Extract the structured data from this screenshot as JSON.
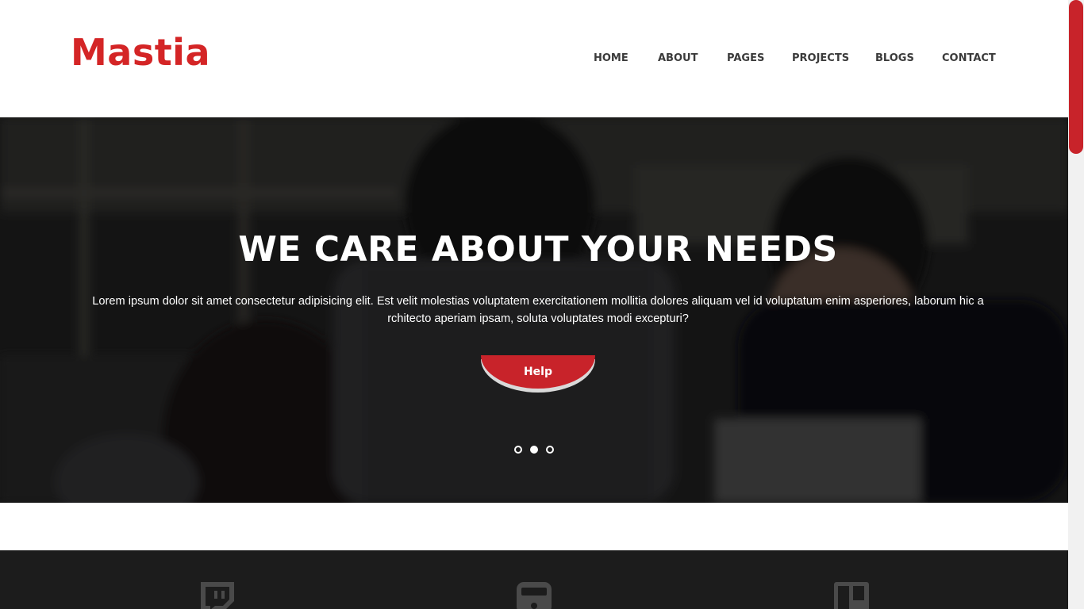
{
  "brand": {
    "logo": "Mastia"
  },
  "nav": [
    {
      "label": "HOME"
    },
    {
      "label": "ABOUT"
    },
    {
      "label": "PAGES"
    },
    {
      "label": "PROJECTS"
    },
    {
      "label": "BLOGS"
    },
    {
      "label": "CONTACT"
    }
  ],
  "hero": {
    "title": "WE CARE ABOUT YOUR NEEDS",
    "text": "Lorem ipsum dolor sit amet consectetur adipisicing elit. Est velit molestias voluptatem exercitationem mollitia dolores aliquam vel id voluptatum enim asperiores, laborum hic a rchitecto aperiam ipsam, soluta voluptates modi excepturi?",
    "button_label": "Help",
    "slides": {
      "count": 3,
      "active_index": 1
    }
  },
  "features": {
    "icons": [
      "twitch-icon",
      "device-icon",
      "trello-icon"
    ]
  },
  "colors": {
    "brand": "#d42526",
    "button": "#c8232a",
    "nav_text": "#3b3b3b",
    "dark_strip": "#1c1c1c"
  }
}
